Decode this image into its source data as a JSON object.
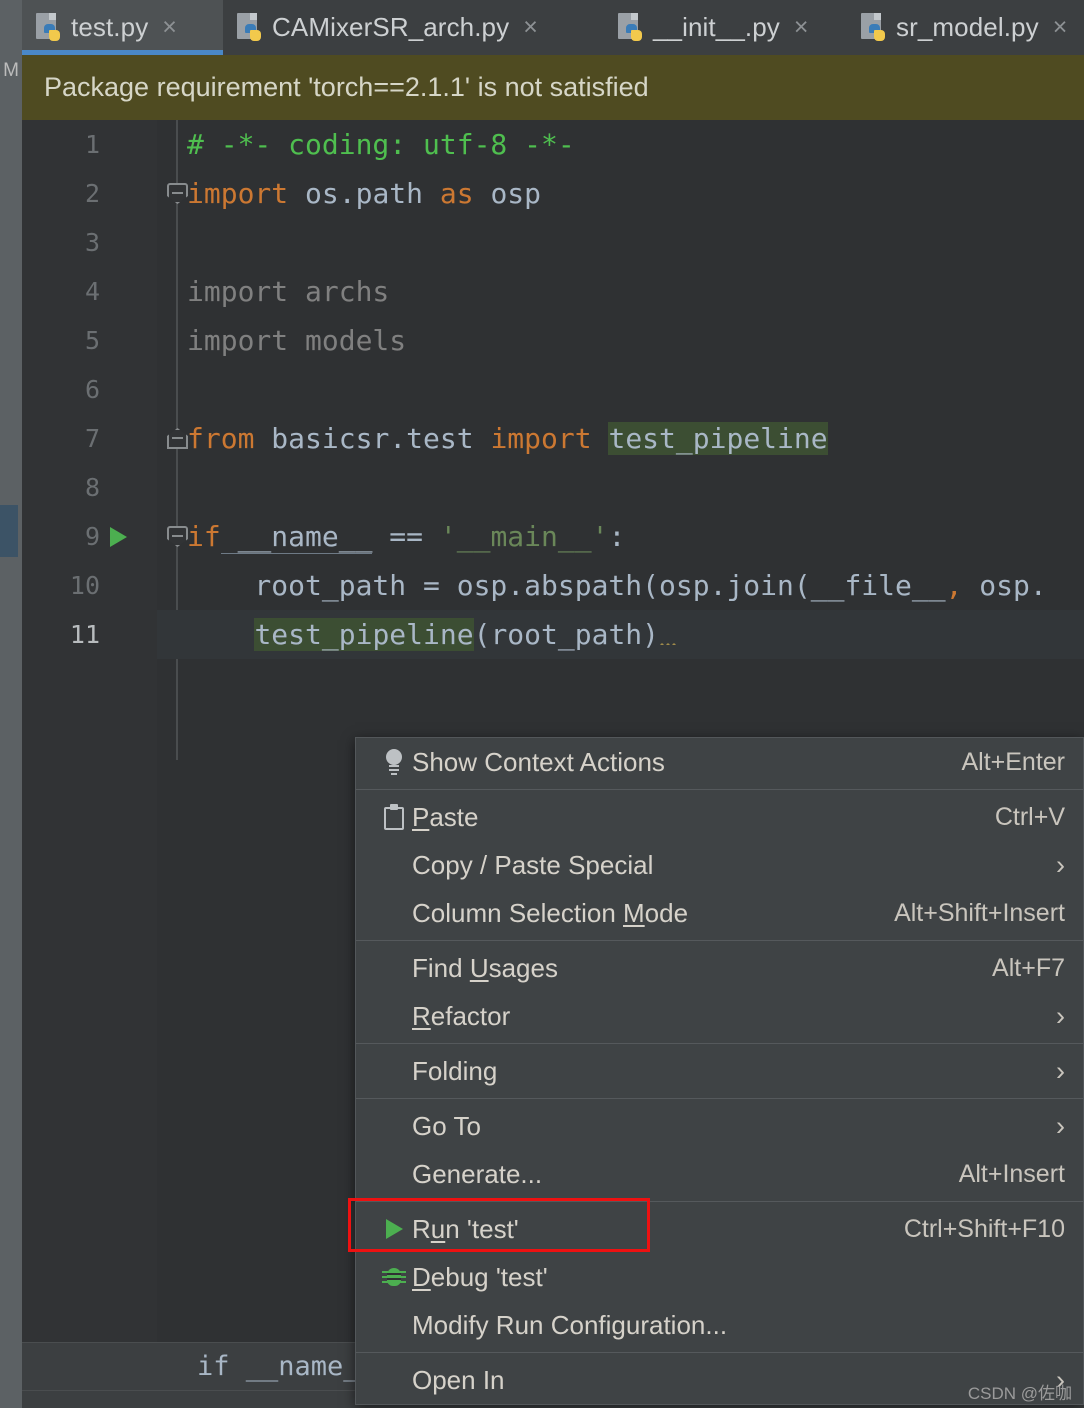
{
  "window": {
    "left_strip_label": "M"
  },
  "tabs": [
    {
      "label": "test.py",
      "icon": "python-file-icon",
      "active": true,
      "close": "×"
    },
    {
      "label": "CAMixerSR_arch.py",
      "icon": "python-file-icon",
      "active": false,
      "close": "×"
    },
    {
      "label": "__init__.py",
      "icon": "python-file-icon",
      "active": false,
      "close": "×"
    },
    {
      "label": "sr_model.py",
      "icon": "python-file-icon",
      "active": false,
      "close": "×"
    }
  ],
  "banner": {
    "message": "Package requirement 'torch==2.1.1' is not satisfied",
    "background": "#4f4b21"
  },
  "editor": {
    "line_numbers": [
      "1",
      "2",
      "3",
      "4",
      "5",
      "6",
      "7",
      "8",
      "9",
      "10",
      "11"
    ],
    "current_line": 11,
    "run_marker_line": 9,
    "lines": [
      {
        "n": 1,
        "text": "# -*- coding: utf-8 -*-"
      },
      {
        "n": 2,
        "text": "import os.path as osp"
      },
      {
        "n": 3,
        "text": ""
      },
      {
        "n": 4,
        "text": "import archs"
      },
      {
        "n": 5,
        "text": "import models"
      },
      {
        "n": 6,
        "text": ""
      },
      {
        "n": 7,
        "text": "from basicsr.test import test_pipeline"
      },
      {
        "n": 8,
        "text": ""
      },
      {
        "n": 9,
        "text": "if __name__ == '__main__':"
      },
      {
        "n": 10,
        "text": "    root_path = osp.abspath(osp.join(__file__, osp."
      },
      {
        "n": 11,
        "text": "    test_pipeline(root_path)"
      }
    ],
    "tokens": {
      "l1_comment": "# -*- coding: utf-8 -*-",
      "l2_import": "import",
      "l2_module": " os.path ",
      "l2_as": "as",
      "l2_alias": " osp",
      "l4": "import archs",
      "l5": "import models",
      "l7_from": "from",
      "l7_module": " basicsr.test ",
      "l7_import": "import",
      "l7_space": " ",
      "l7_name": "test_pipeline",
      "l9_if": "if",
      "l9_name": " __name__",
      "l9_eq": " == ",
      "l9_str": "'__main__'",
      "l9_colon": ":",
      "l10_a": "    root_path = osp.abspath(osp.join(__file__",
      "l10_comma": ",",
      "l10_b": " osp.",
      "l11_indent": "    ",
      "l11_call": "test_pipeline",
      "l11_args": "(root_path)"
    },
    "colors": {
      "background": "#2f3133",
      "gutter": "#313335",
      "keyword": "#cc7832",
      "comment": "#4fbf4f",
      "string": "#6a8759",
      "identifier": "#a9b7c6",
      "unused": "#808080",
      "occurrence_highlight": "#3c4e33",
      "run_marker": "#4caf50"
    }
  },
  "context_menu": {
    "items": [
      {
        "label": "Show Context Actions",
        "shortcut": "Alt+Enter",
        "icon": "lightbulb-icon",
        "arrow": "",
        "mnemonic": ""
      },
      {
        "label": "Paste",
        "shortcut": "Ctrl+V",
        "icon": "clipboard-icon",
        "arrow": "",
        "mnemonic": "P"
      },
      {
        "label": "Copy / Paste Special",
        "shortcut": "",
        "icon": "",
        "arrow": "›",
        "mnemonic": ""
      },
      {
        "label": "Column Selection Mode",
        "shortcut": "Alt+Shift+Insert",
        "icon": "",
        "arrow": "",
        "mnemonic": "M"
      },
      {
        "label": "Find Usages",
        "shortcut": "Alt+F7",
        "icon": "",
        "arrow": "",
        "mnemonic": "U"
      },
      {
        "label": "Refactor",
        "shortcut": "",
        "icon": "",
        "arrow": "›",
        "mnemonic": "R"
      },
      {
        "label": "Folding",
        "shortcut": "",
        "icon": "",
        "arrow": "›",
        "mnemonic": ""
      },
      {
        "label": "Go To",
        "shortcut": "",
        "icon": "",
        "arrow": "›",
        "mnemonic": ""
      },
      {
        "label": "Generate...",
        "shortcut": "Alt+Insert",
        "icon": "",
        "arrow": "",
        "mnemonic": ""
      },
      {
        "label": "Run 'test'",
        "shortcut": "Ctrl+Shift+F10",
        "icon": "run-play-icon",
        "arrow": "",
        "mnemonic": "u"
      },
      {
        "label": "Debug 'test'",
        "shortcut": "",
        "icon": "debug-bug-icon",
        "arrow": "",
        "mnemonic": "D"
      },
      {
        "label": "Modify Run Configuration...",
        "shortcut": "",
        "icon": "",
        "arrow": "",
        "mnemonic": ""
      },
      {
        "label": "Open In",
        "shortcut": "",
        "icon": "",
        "arrow": "›",
        "mnemonic": ""
      }
    ],
    "annotation": {
      "target": "Run 'test'",
      "color": "#ee1111"
    }
  },
  "breadcrumb": {
    "text": "if __name__ =="
  },
  "watermark": {
    "text": "CSDN @佐咖"
  }
}
